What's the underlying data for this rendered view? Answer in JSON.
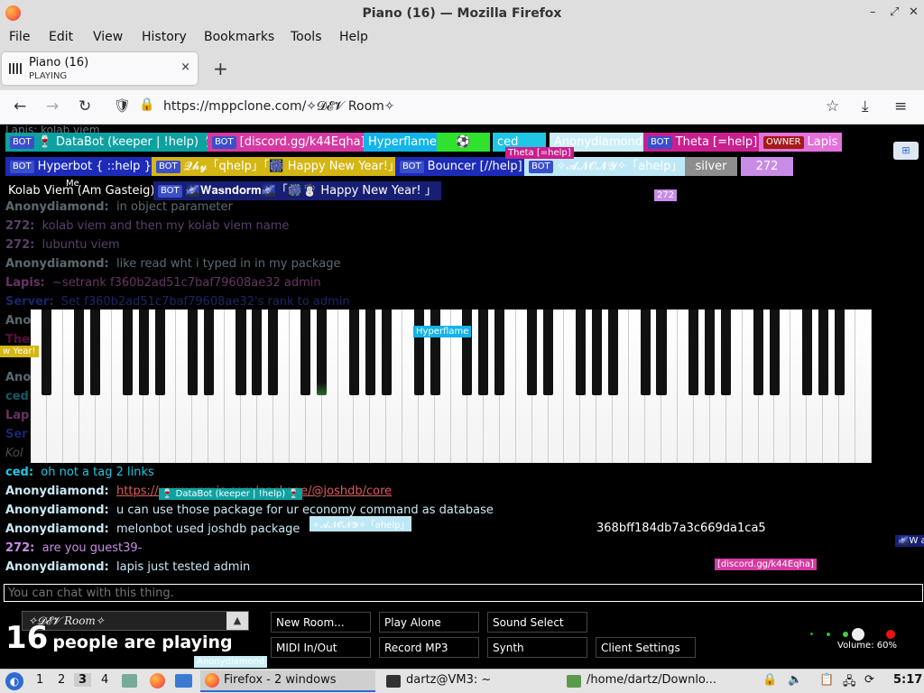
{
  "window": {
    "title": "Piano (16) — Mozilla Firefox",
    "controls": [
      "–",
      "⤢",
      "✕"
    ]
  },
  "menu": [
    "File",
    "Edit",
    "View",
    "History",
    "Bookmarks",
    "Tools",
    "Help"
  ],
  "tab": {
    "title": "Piano (16)",
    "status": "PLAYING",
    "close": "×",
    "new": "+"
  },
  "nav": {
    "url": "https://mppclone.com/✧𝓓𝓔𝓥 Room✧"
  },
  "users": [
    {
      "badge": "BOT",
      "name": "🍷 DataBot (keeper | !help) 🍷",
      "bg": "#0fa1a1"
    },
    {
      "badge": "BOT",
      "name": "[discord.gg/k44Eqha]",
      "bg": "#d63aa1"
    },
    {
      "name": "Hyperflame",
      "bg": "#12b4ea"
    },
    {
      "name": "⚽",
      "bg": "#2ee22e"
    },
    {
      "name": "ced",
      "bg": "#1fc7e5"
    },
    {
      "name": "Anonydiamond",
      "bg": "#cbeef7"
    },
    {
      "badge": "BOT",
      "name": "Theta [=help]",
      "bg": "#c91f8f"
    },
    {
      "owner": "OWNER",
      "name": "Lapis",
      "bg": "#e571db"
    },
    {
      "badge": "BOT",
      "name": "Hyperbot { ::help }",
      "bg": "#1d2bb9"
    },
    {
      "badge": "BOT",
      "name": "𝓠𝓱𝔂「qhelp」「🎆 Happy New Year!」",
      "bg": "#d4b614"
    },
    {
      "badge": "BOT",
      "name": "Bouncer [//help]",
      "bg": "#1d2bb9"
    },
    {
      "badge": "BOT",
      "name": "✧𝓐𝓝𝓞𝓝𝓨✧「ahelp」",
      "bg": "#bfe8f6"
    },
    {
      "name": "silver",
      "bg": "#8d8d8d"
    },
    {
      "name": "272",
      "bg": "#c88ce7"
    },
    {
      "name": "Kolab Viem (Am Gasteig)",
      "bg": "#000"
    },
    {
      "badge": "BOT",
      "name": "🌌𝐖𝐚𝐬𝐧𝐝𝐨𝐫𝐦🌌「🎆☃️ Happy New Year! 」",
      "bg": "#171e73"
    }
  ],
  "chat_top": [
    {
      "user": "Anonydiamond:",
      "msg": "in object parameter",
      "color": "#c8e9f5"
    },
    {
      "user": "272:",
      "msg": "kolab viem and then my kolab viem name",
      "color": "#c88ce7"
    },
    {
      "user": "272:",
      "msg": "lubuntu viem",
      "color": "#c88ce7"
    },
    {
      "user": "Anonydiamond:",
      "msg": "like read wht i typed in in my package",
      "color": "#c8e9f5"
    },
    {
      "user": "Lapis:",
      "msg": "~setrank f360b2ad51c7baf79608ae32 admin",
      "color": "#e571db"
    },
    {
      "user": "Server:",
      "msg": "Set f360b2ad51c7baf79608ae32's rank to admin",
      "color": "#3955e3"
    }
  ],
  "chat_bottom": [
    {
      "user": "ced:",
      "msg": "oh not a tag 2 links",
      "color": "#1fc7e5"
    },
    {
      "user": "Anonydiamond:",
      "msg": "https://www.npmjs.com/package/@joshdb/core",
      "color": "#c8e9f5",
      "link": true
    },
    {
      "user": "Anonydiamond:",
      "msg": "u can use those package for ur economy command as database",
      "color": "#c8e9f5"
    },
    {
      "user": "Anonydiamond:",
      "msg": "melonbot used joshdb package",
      "color": "#c8e9f5"
    },
    {
      "user": "272:",
      "msg": "are you guest39-",
      "color": "#c88ce7"
    },
    {
      "user": "Anonydiamond:",
      "msg": "lapis just tested admin",
      "color": "#c8e9f5"
    }
  ],
  "hidden_chat_prefixes": [
    "Ano",
    "The",
    "Ano",
    "ced",
    "Lap",
    "Ser",
    "Kol"
  ],
  "cursors": {
    "theta": "Theta [=help]",
    "me": "Me",
    "c272": "272",
    "hyperflame": "Hyperflame",
    "newyear": "w Year!",
    "databot": "🍷 DataBot (keeper | !help) 🍷",
    "anony": "✧𝓐𝓝𝓞𝓝𝓨✧「ahelp」",
    "anonydiamond": "Anonydiamond",
    "discord": "[discord.gg/k44Eqha]",
    "wasn": "🌌W a"
  },
  "floating_id": "368bff184db7a3c669da1ca5",
  "chat_placeholder": "You can chat with this thing.",
  "room": {
    "name": "✧𝓓𝓔𝓥 Room✧",
    "count": "16",
    "count_label": "people are playing"
  },
  "buttons": [
    "New Room...",
    "Play Alone",
    "Sound Select",
    "MIDI In/Out",
    "Record MP3",
    "Synth",
    "Client Settings"
  ],
  "volume": "Volume: 60%",
  "taskbar": {
    "workspaces": [
      "1",
      "2",
      "3",
      "4"
    ],
    "items": [
      "Firefox - 2 windows",
      "dartz@VM3: ~",
      "/home/dartz/Downlo..."
    ],
    "clock": "5:17"
  }
}
